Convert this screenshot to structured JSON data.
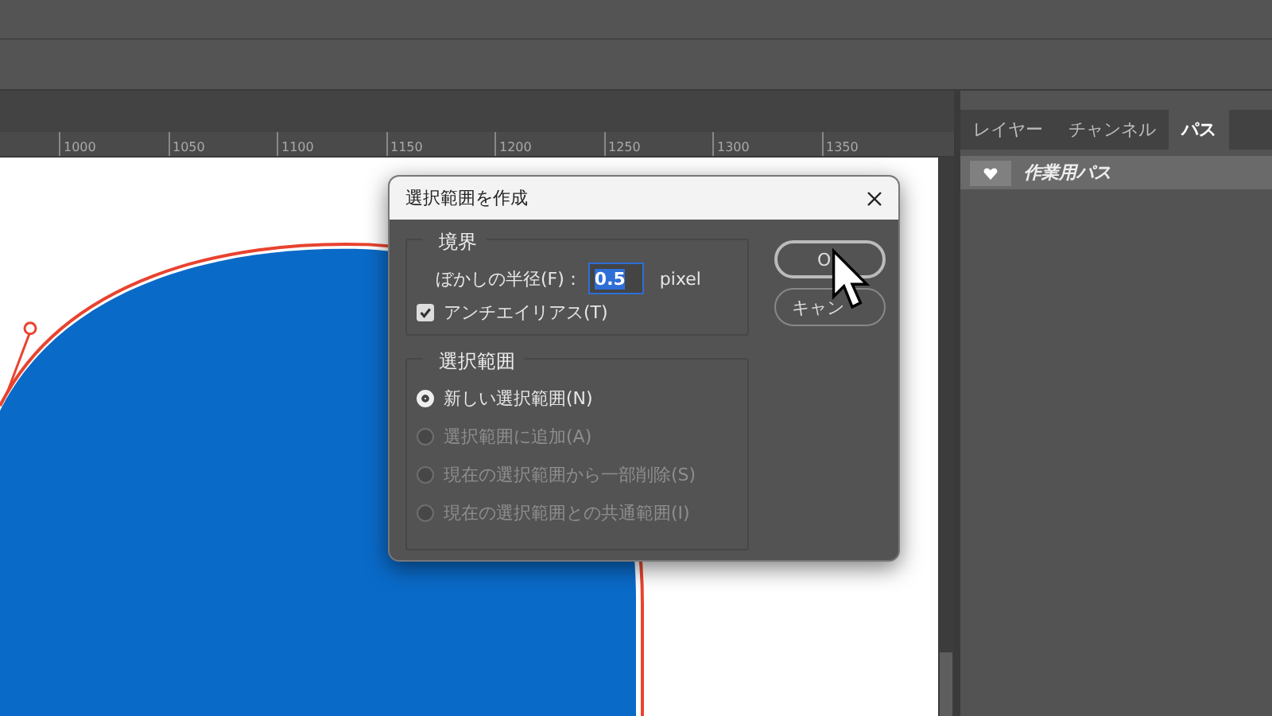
{
  "ruler": {
    "labels": [
      "1000",
      "1050",
      "1100",
      "1150",
      "1200",
      "1250",
      "1300",
      "1350"
    ]
  },
  "panel": {
    "tabs": [
      {
        "label": "レイヤー",
        "selected": false
      },
      {
        "label": "チャンネル",
        "selected": false
      },
      {
        "label": "パス",
        "selected": true
      }
    ],
    "paths": [
      {
        "name": "作業用パス",
        "selected": true
      }
    ]
  },
  "dialog": {
    "title": "選択範囲を作成",
    "feather_group": {
      "title": "境界",
      "label": "ぼかしの半径(F)：",
      "value": "0.5",
      "unit": "pixel",
      "antialias": {
        "label": "アンチエイリアス(T)",
        "checked": true
      }
    },
    "operation_group": {
      "title": "選択範囲",
      "options": [
        {
          "label": "新しい選択範囲(N)",
          "selected": true,
          "disabled": false
        },
        {
          "label": "選択範囲に追加(A)",
          "selected": false,
          "disabled": true
        },
        {
          "label": "現在の選択範囲から一部削除(S)",
          "selected": false,
          "disabled": true
        },
        {
          "label": "現在の選択範囲との共通範囲(I)",
          "selected": false,
          "disabled": true
        }
      ]
    },
    "buttons": [
      {
        "label": "O"
      },
      {
        "label": "キャン"
      }
    ]
  }
}
